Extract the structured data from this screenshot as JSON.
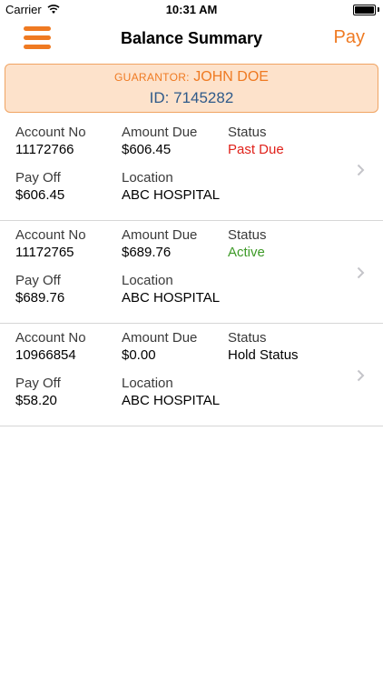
{
  "status_bar": {
    "carrier": "Carrier",
    "time": "10:31 AM",
    "battery_level": 1.0
  },
  "nav": {
    "title": "Balance Summary",
    "pay_label": "Pay",
    "menu_icon": "hamburger-menu-icon"
  },
  "guarantor": {
    "label": "GUARANTOR:",
    "name": "JOHN DOE",
    "id_text": "ID: 7145282"
  },
  "labels": {
    "account_no": "Account No",
    "amount_due": "Amount Due",
    "status": "Status",
    "pay_off": "Pay Off",
    "location": "Location"
  },
  "accounts": [
    {
      "account_no": "11172766",
      "amount_due": "$606.45",
      "status": "Past Due",
      "status_color": "#e0221b",
      "pay_off": "$606.45",
      "location": "ABC HOSPITAL"
    },
    {
      "account_no": "11172765",
      "amount_due": "$689.76",
      "status": "Active",
      "status_color": "#3e9a28",
      "pay_off": "$689.76",
      "location": "ABC HOSPITAL"
    },
    {
      "account_no": "10966854",
      "amount_due": "$0.00",
      "status": "Hold Status",
      "status_color": "#000000",
      "pay_off": "$58.20",
      "location": "ABC HOSPITAL"
    }
  ],
  "colors": {
    "accent": "#ef7a22",
    "guarantor_bg": "#fde2cb",
    "id_blue": "#2f5a8a"
  }
}
